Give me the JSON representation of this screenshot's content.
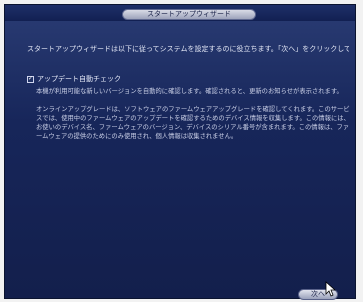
{
  "dialog": {
    "title": "スタートアップウィザード",
    "intro": "スタートアップウィザードは以下に従ってシステムを設定するのに役立ちます。「次へ」をクリックして続行します。",
    "auto_update": {
      "checked": true,
      "label": "アップデート自動チェック",
      "para1": "本機が利用可能な新しいバージョンを自動的に確認します。確認されると、更新のお知らせが表示されます。",
      "para2": "オンラインアップグレードは、ソフトウェアのファームウェアアップグレードを確認してくれます。このサービスでは、使用中のファームウェアのアップデートを確認するためのデバイス情報を収集します。この情報には、お使いのデバイス名、ファームウェアのバージョン、デバイスのシリアル番号が含まれます。この情報は、ファームウェアの提供のためにのみ使用され、個人情報は収集されません。"
    },
    "next_label": "次へ"
  }
}
